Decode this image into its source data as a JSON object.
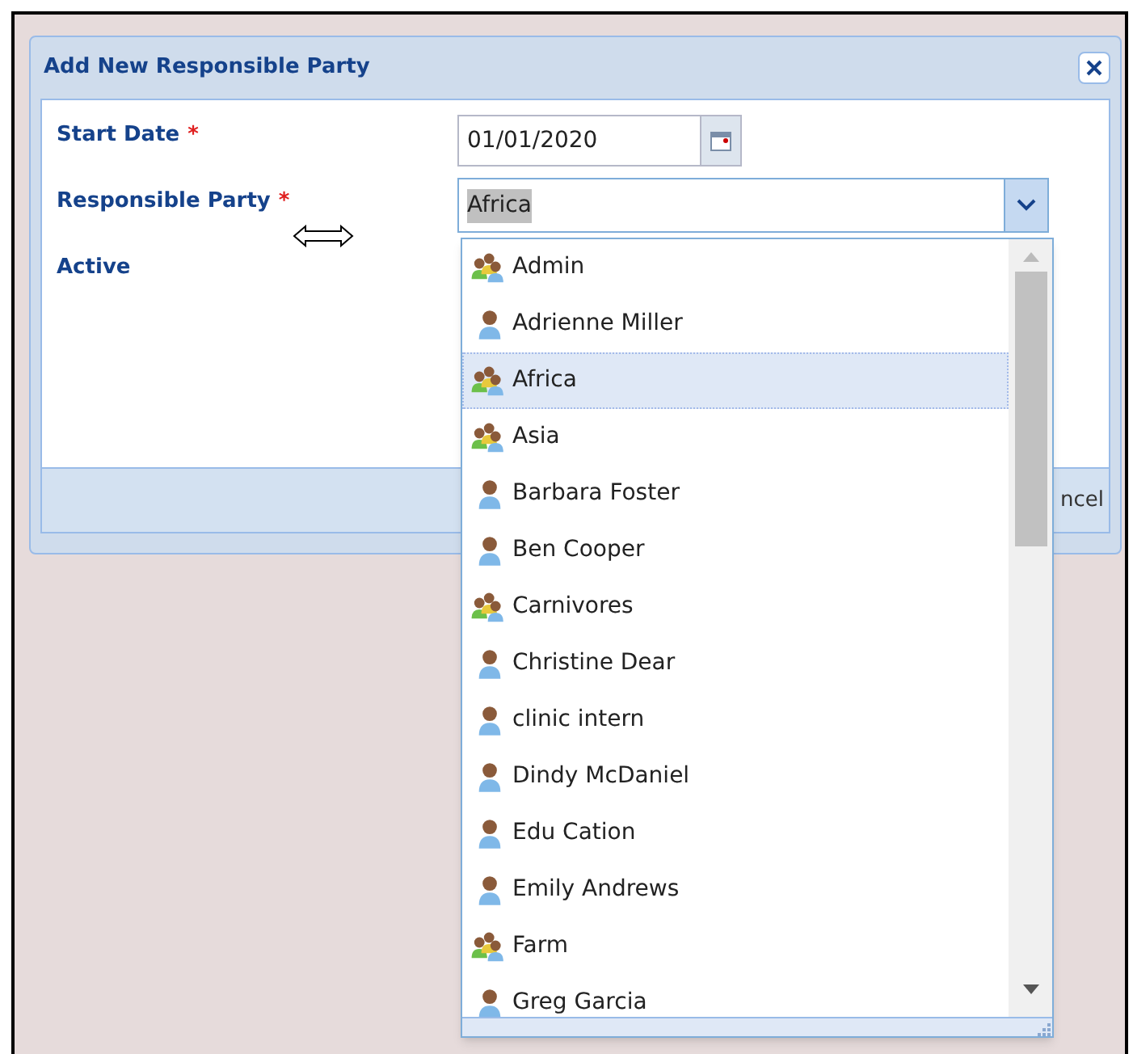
{
  "dialog": {
    "title": "Add New Responsible Party",
    "fields": [
      {
        "label": "Start Date",
        "required_mark": "*",
        "kind": "date",
        "value": "01/01/2020"
      },
      {
        "label": "Responsible Party",
        "required_mark": "*",
        "kind": "combo",
        "value": "Africa"
      },
      {
        "label": "Active",
        "kind": "check"
      }
    ],
    "footer_button": "ncel"
  },
  "dropdown": {
    "items": [
      {
        "label": "Admin",
        "kind": "group",
        "selected": false
      },
      {
        "label": "Adrienne Miller",
        "kind": "person",
        "selected": false
      },
      {
        "label": "Africa",
        "kind": "group",
        "selected": true
      },
      {
        "label": "Asia",
        "kind": "group",
        "selected": false
      },
      {
        "label": "Barbara Foster",
        "kind": "person",
        "selected": false
      },
      {
        "label": "Ben Cooper",
        "kind": "person",
        "selected": false
      },
      {
        "label": "Carnivores",
        "kind": "group",
        "selected": false
      },
      {
        "label": "Christine Dear",
        "kind": "person",
        "selected": false
      },
      {
        "label": "clinic intern",
        "kind": "person",
        "selected": false
      },
      {
        "label": "Dindy McDaniel",
        "kind": "person",
        "selected": false
      },
      {
        "label": "Edu Cation",
        "kind": "person",
        "selected": false
      },
      {
        "label": "Emily Andrews",
        "kind": "person",
        "selected": false
      },
      {
        "label": "Farm",
        "kind": "group",
        "selected": false
      },
      {
        "label": "Greg Garcia",
        "kind": "person",
        "selected": false
      }
    ]
  }
}
